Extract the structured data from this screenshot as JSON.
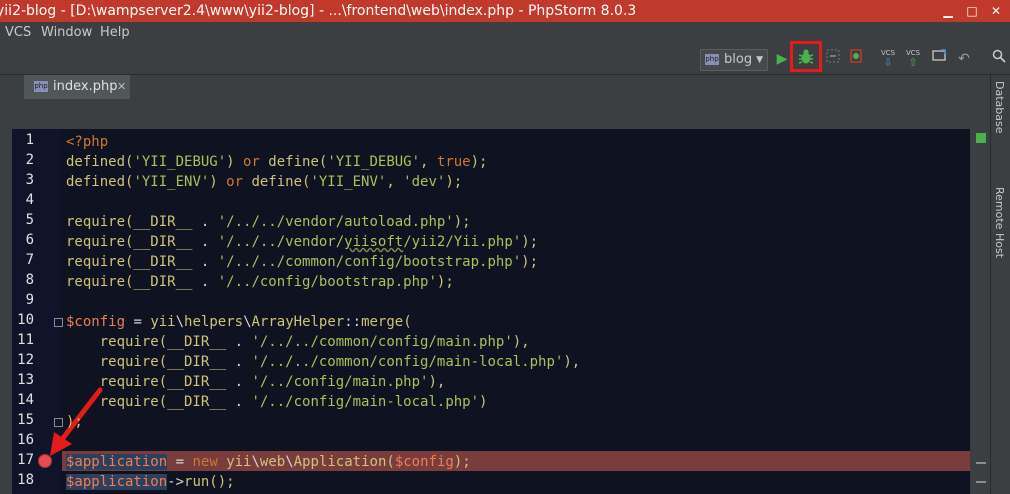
{
  "window": {
    "title": "yii2-blog - [D:\\wampserver2.4\\www\\yii2-blog] - ...\\frontend\\web\\index.php - PhpStorm 8.0.3",
    "minimize": "▁",
    "maximize": "□",
    "close": "✕"
  },
  "menu": {
    "items": [
      {
        "label": "VCS"
      },
      {
        "label": "Window"
      },
      {
        "label": "Help"
      }
    ]
  },
  "toolbar": {
    "run_config": "blog",
    "run_icon": "run-icon",
    "debug_icon": "debug-icon",
    "vcs_label": "VCS"
  },
  "editor": {
    "tab": {
      "label": "index.php",
      "close": "✕"
    },
    "code_lines": [
      "<?php",
      "defined('YII_DEBUG') or define('YII_DEBUG', true);",
      "defined('YII_ENV') or define('YII_ENV', 'dev');",
      "",
      "require(__DIR__ . '/../../vendor/autoload.php');",
      "require(__DIR__ . '/../../vendor/yiisoft/yii2/Yii.php');",
      "require(__DIR__ . '/../../common/config/bootstrap.php');",
      "require(__DIR__ . '/../config/bootstrap.php');",
      "",
      "$config = yii\\helpers\\ArrayHelper::merge(",
      "    require(__DIR__ . '/../../common/config/main.php'),",
      "    require(__DIR__ . '/../../common/config/main-local.php'),",
      "    require(__DIR__ . '/../config/main.php'),",
      "    require(__DIR__ . '/../config/main-local.php')",
      ");",
      "",
      "$application = new yii\\web\\Application($config);",
      "$application->run();"
    ],
    "line_numbers": [
      "1",
      "2",
      "3",
      "4",
      "5",
      "6",
      "7",
      "8",
      "9",
      "10",
      "11",
      "12",
      "13",
      "14",
      "15",
      "16",
      "17",
      "18"
    ],
    "breakpoint_line": 17
  },
  "side_panels": {
    "database": "Database",
    "remote_host": "Remote Host"
  },
  "colors": {
    "title_bar": "#c0392b",
    "editor_bg": "#0f1221",
    "breakpoint_line": "#7a3d3e",
    "annotation_red": "#e31b1b"
  }
}
